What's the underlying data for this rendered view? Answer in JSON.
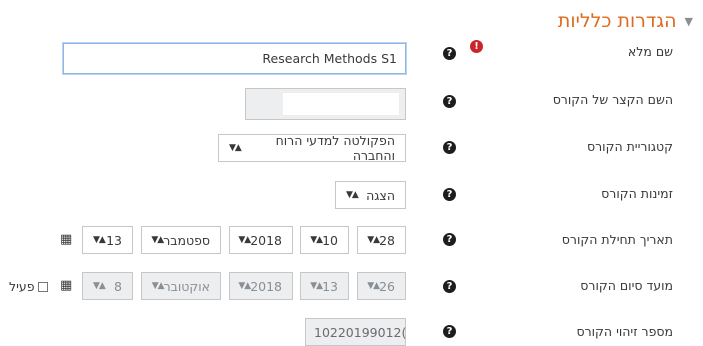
{
  "section": {
    "title": "הגדרות כלליות",
    "toggle_icon": "caret-down-icon"
  },
  "fields": {
    "fullname": {
      "label": "שם מלא",
      "value": "Research Methods S1"
    },
    "shortname": {
      "label": "השם הקצר של הקורס",
      "value": ""
    },
    "category": {
      "label": "קטגוריית הקורס",
      "value": "הפקולטה למדעי הרוח והחברה"
    },
    "visibility": {
      "label": "זמינות הקורס",
      "value": "הצגה"
    },
    "startdate": {
      "label": "תאריך תחילת הקורס",
      "day": "28",
      "hour": "10",
      "year": "2018",
      "month": "ספטמבר",
      "minute": "13"
    },
    "enddate": {
      "label": "מועד סיום הקורס",
      "day": "26",
      "hour": "13",
      "year": "2018",
      "month": "אוקטובר",
      "minute": "8",
      "enable_label": "פעיל"
    },
    "idnumber": {
      "label": "מספר זיהוי הקורס",
      "value": "10220199012("
    }
  },
  "icons": {
    "help": "?",
    "required": "!",
    "select_arrows": "▲▼"
  }
}
